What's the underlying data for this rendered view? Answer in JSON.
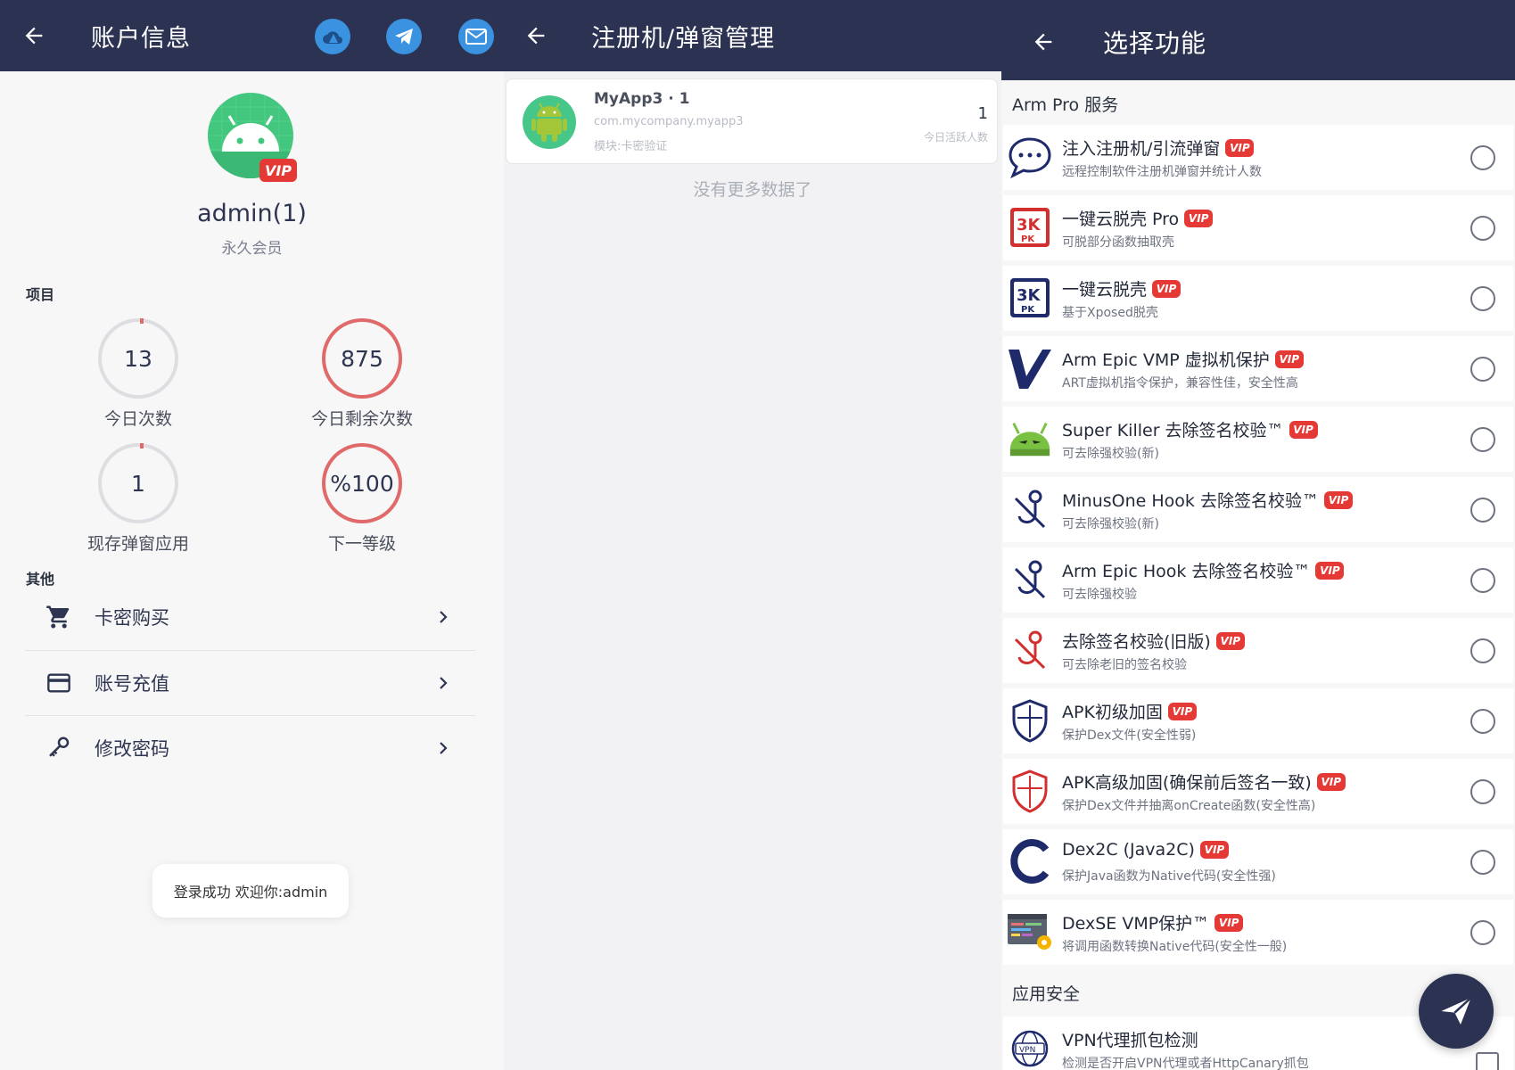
{
  "account": {
    "title": "账户信息",
    "icons": [
      "cloud-icon",
      "telegram-icon",
      "mail-icon"
    ],
    "username": "admin(1)",
    "membership": "永久会员",
    "vip_label": "VIP",
    "projects_label": "项目",
    "stats": [
      {
        "value": "13",
        "label": "今日次数"
      },
      {
        "value": "875",
        "label": "今日剩余次数"
      },
      {
        "value": "1",
        "label": "现存弹窗应用"
      },
      {
        "value": "%100",
        "label": "下一等级"
      }
    ],
    "other_label": "其他",
    "menu": [
      {
        "label": "卡密购买",
        "icon": "cart-icon"
      },
      {
        "label": "账号充值",
        "icon": "credit-card-icon"
      },
      {
        "label": "修改密码",
        "icon": "key-icon"
      }
    ],
    "toast": "登录成功 欢迎你:admin"
  },
  "register": {
    "title": "注册机/弹窗管理",
    "app": {
      "name": "MyApp3 · 1",
      "package": "com.mycompany.myapp3",
      "module": "模块:卡密验证",
      "count": "1",
      "count_label": "今日活跃人数"
    },
    "no_more": "没有更多数据了"
  },
  "functions": {
    "title": "选择功能",
    "group1": "Arm Pro 服务",
    "items": [
      {
        "title": "注入注册机/引流弹窗",
        "subtitle": "远程控制软件注册机弹窗并统计人数",
        "icon": "chat-bubble-icon"
      },
      {
        "title": "一键云脱壳 Pro",
        "subtitle": "可脱部分函数抽取壳",
        "icon": "unpack-pro-icon"
      },
      {
        "title": "一键云脱壳",
        "subtitle": "基于Xposed脱壳",
        "icon": "unpack-icon"
      },
      {
        "title": "Arm Epic VMP 虚拟机保护",
        "subtitle": "ART虚拟机指令保护，兼容性佳，安全性高",
        "icon": "v-logo-icon"
      },
      {
        "title": "Super Killer 去除签名校验™",
        "subtitle": "可去除强校验(新)",
        "icon": "android-killer-icon"
      },
      {
        "title": "MinusOne Hook 去除签名校验™",
        "subtitle": "可去除强校验(新)",
        "icon": "hook-icon"
      },
      {
        "title": "Arm Epic Hook 去除签名校验™",
        "subtitle": "可去除强校验",
        "icon": "hook-icon"
      },
      {
        "title": "去除签名校验(旧版)",
        "subtitle": "可去除老旧的签名校验",
        "icon": "hook-red-icon"
      },
      {
        "title": "APK初级加固",
        "subtitle": "保护Dex文件(安全性弱)",
        "icon": "shield-icon"
      },
      {
        "title": "APK高级加固(确保前后签名一致)",
        "subtitle": "保护Dex文件并抽离onCreate函数(安全性高)",
        "icon": "shield-red-icon"
      },
      {
        "title": "Dex2C (Java2C)",
        "subtitle": "保护Java函数为Native代码(安全性强)",
        "icon": "c-logo-icon"
      },
      {
        "title": "DexSE VMP保护™",
        "subtitle": "将调用函数转换Native代码(安全性一般)",
        "icon": "code-gear-icon"
      }
    ],
    "group2": "应用安全",
    "security_item": {
      "title": "VPN代理抓包检测",
      "subtitle": "检测是否开启VPN代理或者HttpCanary抓包",
      "icon": "vpn-icon"
    },
    "fab_icon": "send-icon"
  },
  "colors": {
    "appbar": "#2c3252",
    "vip": "#e53935",
    "ring_red": "#e06a6a",
    "avatar_green": "#43c67e"
  }
}
